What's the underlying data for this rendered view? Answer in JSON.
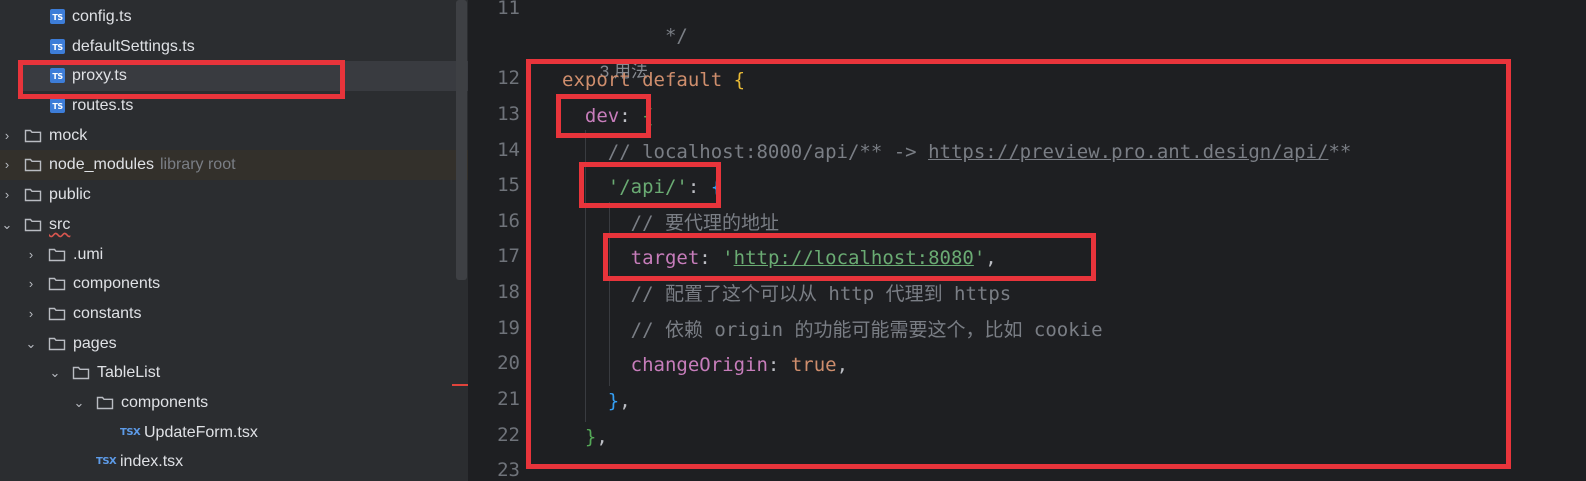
{
  "project_tree": {
    "items": [
      {
        "label": "config.ts",
        "kind": "ts",
        "icon": "typescript-file-icon",
        "icon_text": "TS",
        "note": ""
      },
      {
        "label": "defaultSettings.ts",
        "kind": "ts",
        "icon": "typescript-file-icon",
        "icon_text": "TS",
        "note": ""
      },
      {
        "label": "proxy.ts",
        "kind": "ts",
        "icon": "typescript-file-icon",
        "icon_text": "TS",
        "note": "",
        "selected": true
      },
      {
        "label": "routes.ts",
        "kind": "ts",
        "icon": "typescript-file-icon",
        "icon_text": "TS",
        "note": ""
      },
      {
        "label": "mock",
        "kind": "folder",
        "icon": "folder-icon",
        "expanded": false
      },
      {
        "label": "node_modules",
        "kind": "folder",
        "icon": "folder-icon",
        "expanded": false,
        "note": "library root"
      },
      {
        "label": "public",
        "kind": "folder",
        "icon": "folder-icon",
        "expanded": false
      },
      {
        "label": "src",
        "kind": "folder",
        "icon": "folder-icon",
        "expanded": true
      },
      {
        "label": ".umi",
        "kind": "folder",
        "icon": "folder-icon",
        "expanded": false
      },
      {
        "label": "components",
        "kind": "folder",
        "icon": "folder-icon",
        "expanded": false
      },
      {
        "label": "constants",
        "kind": "folder",
        "icon": "folder-icon",
        "expanded": false
      },
      {
        "label": "pages",
        "kind": "folder",
        "icon": "folder-icon",
        "expanded": true
      },
      {
        "label": "TableList",
        "kind": "folder",
        "icon": "folder-icon",
        "expanded": true
      },
      {
        "label": "components",
        "kind": "folder",
        "icon": "folder-icon",
        "expanded": true
      },
      {
        "label": "UpdateForm.tsx",
        "kind": "tsx",
        "icon": "tsx-file-icon",
        "icon_text": "TSX"
      },
      {
        "label": "index.tsx",
        "kind": "tsx",
        "icon": "tsx-file-icon",
        "icon_text": "TSX"
      }
    ]
  },
  "editor": {
    "usage_hint": "3 用法",
    "line_numbers": [
      "11",
      "12",
      "13",
      "14",
      "15",
      "16",
      "17",
      "18",
      "19",
      "20",
      "21",
      "22",
      "23"
    ],
    "code": {
      "l11": " */",
      "l12_kw": "export default",
      "l12_brace": "{",
      "l13_prop": "dev",
      "l13_colon": ":",
      "l13_brace": "{",
      "l14_comment_prefix": "// localhost:8000/api/** -> ",
      "l14_comment_link": "https://preview.pro.ant.design/api/",
      "l14_comment_suffix": "**",
      "l15_str": "'/api/'",
      "l15_colon": ":",
      "l15_brace": "{",
      "l16_comment": "// 要代理的地址",
      "l17_prop": "target",
      "l17_colon": ": ",
      "l17_quote_open": "'",
      "l17_link": "http://localhost:8080",
      "l17_quote_close": "'",
      "l17_comma": ",",
      "l18_comment": "// 配置了这个可以从 http 代理到 https",
      "l19_comment": "// 依赖 origin 的功能可能需要这个，比如 cookie",
      "l20_prop": "changeOrigin",
      "l20_colon": ": ",
      "l20_kw": "true",
      "l20_comma": ",",
      "l21_brace": "}",
      "l21_comma": ",",
      "l22_brace": "}",
      "l22_comma": ","
    }
  },
  "colors": {
    "annotation_red": "#e8343b",
    "keyword": "#cf8e6d",
    "property": "#c77dbb",
    "string": "#6aab73",
    "comment": "#7a7e85"
  }
}
